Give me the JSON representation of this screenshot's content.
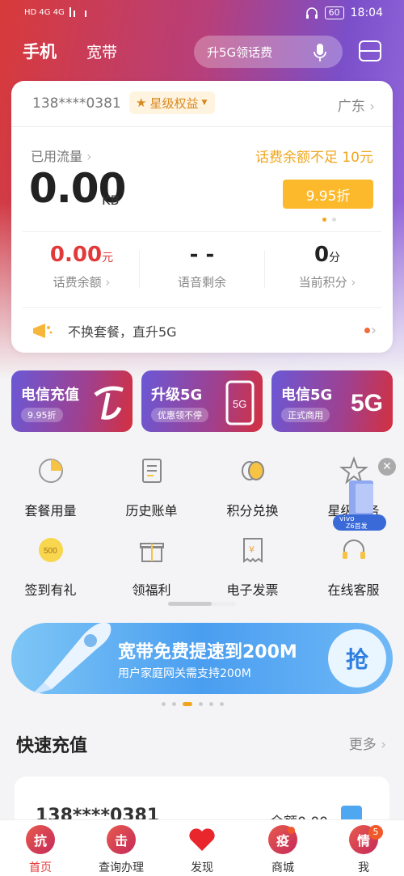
{
  "status_bar": {
    "left": "HD 4G 4G",
    "battery": "60",
    "time": "18:04"
  },
  "top_nav": {
    "tab_phone": "手机",
    "tab_broadband": "宽带",
    "search_text": "升5G领话费"
  },
  "account": {
    "number": "138****0381",
    "star_badge": "星级权益",
    "province": "广东",
    "used_label": "已用流量",
    "used_value": "0.00",
    "used_unit": "KB",
    "warning": "话费余额不足 10元",
    "discount_button": "9.95折",
    "stats": [
      {
        "value": "0.00",
        "unit": "元",
        "label": "话费余额"
      },
      {
        "value": "- -",
        "unit": "",
        "label": "语音剩余"
      },
      {
        "value": "0",
        "unit": "分",
        "label": "当前积分"
      }
    ],
    "promo": "不换套餐，直升5G"
  },
  "banners": [
    {
      "title": "电信充值",
      "sub": "9.95折"
    },
    {
      "title": "升级5G",
      "sub": "优惠领不停"
    },
    {
      "title": "电信5G",
      "sub": "正式商用"
    }
  ],
  "grid": [
    {
      "label": "套餐用量",
      "icon": "pie-chart-icon"
    },
    {
      "label": "历史账单",
      "icon": "bill-icon"
    },
    {
      "label": "积分兑换",
      "icon": "coins-icon"
    },
    {
      "label": "星级服务",
      "icon": "star-icon"
    },
    {
      "label": "签到有礼",
      "icon": "coin-500-icon"
    },
    {
      "label": "领福利",
      "icon": "gift-icon"
    },
    {
      "label": "电子发票",
      "icon": "invoice-icon"
    },
    {
      "label": "在线客服",
      "icon": "headset-icon"
    }
  ],
  "vivo_ad": {
    "brand": "vivo",
    "model": "Z6首发"
  },
  "big_banner": {
    "title": "宽带免费提速到200M",
    "sub": "用户家庭网关需支持200M",
    "button": "抢"
  },
  "quick_recharge": {
    "title": "快速充值",
    "more": "更多",
    "number": "138****0381",
    "balance": "余额0.00"
  },
  "bottom_tabs": [
    {
      "glyph": "抗",
      "label": "首页"
    },
    {
      "glyph": "击",
      "label": "查询办理"
    },
    {
      "glyph": "",
      "label": "发现"
    },
    {
      "glyph": "疫",
      "label": "商城"
    },
    {
      "glyph": "情",
      "label": "我",
      "badge": "5"
    }
  ],
  "colors": {
    "accent_red": "#e23a3a",
    "accent_orange": "#f0a51d",
    "accent_blue": "#4a9ef0"
  }
}
